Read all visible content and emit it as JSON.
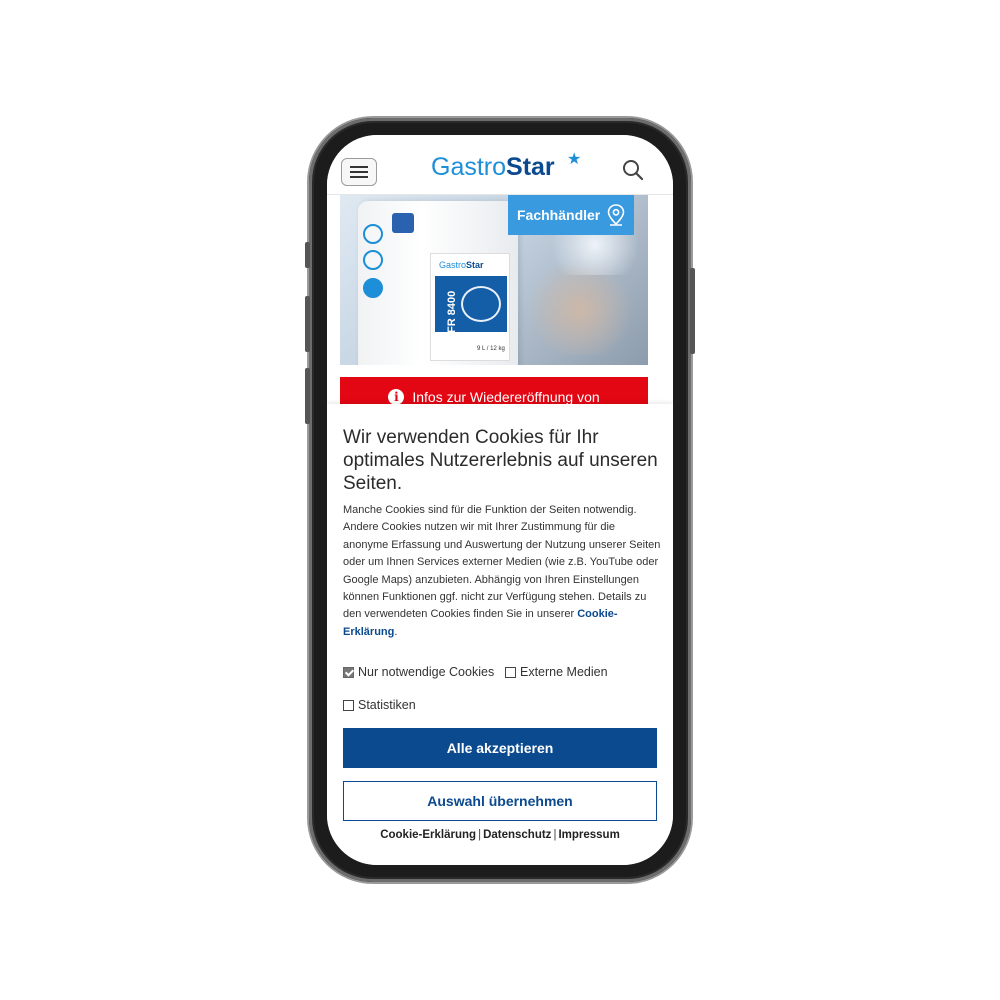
{
  "header": {
    "logo_part1": "Gastro",
    "logo_part2": "Star",
    "logo_star": "★",
    "menu_icon": "hamburger-icon",
    "search_icon": "search-icon"
  },
  "hero": {
    "dealer_label": "Fachhändler",
    "dealer_icon": "map-pin-icon",
    "product": {
      "logo_part1": "Gastro",
      "logo_part2": "Star",
      "name": "FR 8400",
      "weight": "9 L / 12 kg"
    },
    "slider_dots": [
      {
        "active": false
      },
      {
        "active": false
      },
      {
        "active": true
      }
    ]
  },
  "notice": {
    "icon": "info-icon",
    "text": "Infos zur Wiedereröffnung von"
  },
  "cookie": {
    "title": "Wir verwenden Cookies für Ihr optimales Nutzererlebnis auf unseren Seiten.",
    "body": "Manche Cookies sind für die Funktion der Seiten notwendig. Andere Cookies nutzen wir mit Ihrer Zustimmung für die anonyme Erfassung und Auswertung der Nutzung unserer Seiten oder um Ihnen Services externer Medien (wie z.B. YouTube oder Google Maps) anzubieten. Abhängig von Ihren Einstellungen können Funktionen ggf. nicht zur Verfügung stehen. Details zu den verwendeten Cookies finden Sie in unserer ",
    "body_link": "Cookie-Erklärung",
    "body_end": ".",
    "options": [
      {
        "label": "Nur notwendige Cookies",
        "checked": true
      },
      {
        "label": "Externe Medien",
        "checked": false
      },
      {
        "label": "Statistiken",
        "checked": false
      }
    ],
    "accept_all": "Alle akzeptieren",
    "accept_selection": "Auswahl übernehmen",
    "footer_links": [
      "Cookie-Erklärung",
      "Datenschutz",
      "Impressum"
    ],
    "footer_separator": "|"
  },
  "colors": {
    "brand_dark": "#0b4a8e",
    "brand_light": "#1d8ed8",
    "dealer_bg": "#3a9ae0",
    "notice_red": "#e30613"
  }
}
